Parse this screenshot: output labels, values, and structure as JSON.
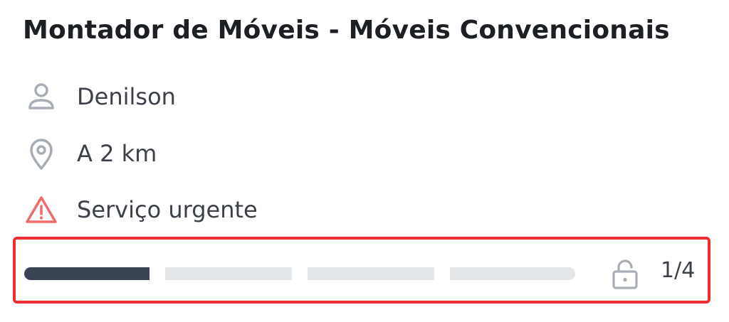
{
  "card": {
    "title": "Montador de Móveis - Móveis Convencionais",
    "user": {
      "icon": "user-icon",
      "label": "Denilson"
    },
    "distance": {
      "icon": "location-pin-icon",
      "label": "A 2 km"
    },
    "urgency": {
      "icon": "warning-icon",
      "label": "Serviço urgente",
      "color": "#ef6b6b"
    }
  },
  "progress": {
    "current_step": 1,
    "total_steps": 4,
    "label": "1/4",
    "icon": "unlocked-padlock-icon",
    "filled_color": "#3a4454",
    "empty_color": "#e4e7ea",
    "highlight_color": "#ee2b2e"
  }
}
